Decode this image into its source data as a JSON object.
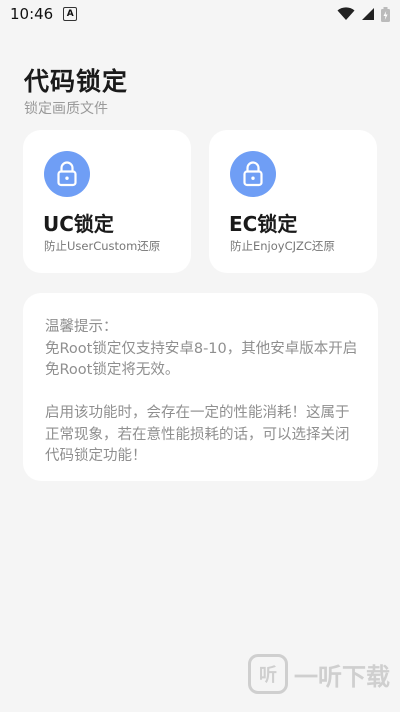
{
  "status_bar": {
    "time": "10:46",
    "notif_glyph": "A",
    "icons": [
      "wifi-icon",
      "signal-icon",
      "battery-icon"
    ]
  },
  "header": {
    "title": "代码锁定",
    "subtitle": "锁定画质文件"
  },
  "cards": [
    {
      "title": "UC锁定",
      "desc": "防止UserCustom还原",
      "icon": "lock-icon"
    },
    {
      "title": "EC锁定",
      "desc": "防止EnjoyCJZC还原",
      "icon": "lock-icon"
    }
  ],
  "notice": {
    "heading": "温馨提示：",
    "para1": "免Root锁定仅支持安卓8-10，其他安卓版本开启免Root锁定将无效。",
    "para2": "启用该功能时，会存在一定的性能消耗！这属于正常现象，若在意性能损耗的话，可以选择关闭代码锁定功能！"
  },
  "watermark": {
    "glyph": "听",
    "text": "一听下载"
  },
  "colors": {
    "accent": "#6f9ef5",
    "background": "#f5f5f5",
    "card": "#ffffff",
    "muted": "#8f8f8f"
  }
}
